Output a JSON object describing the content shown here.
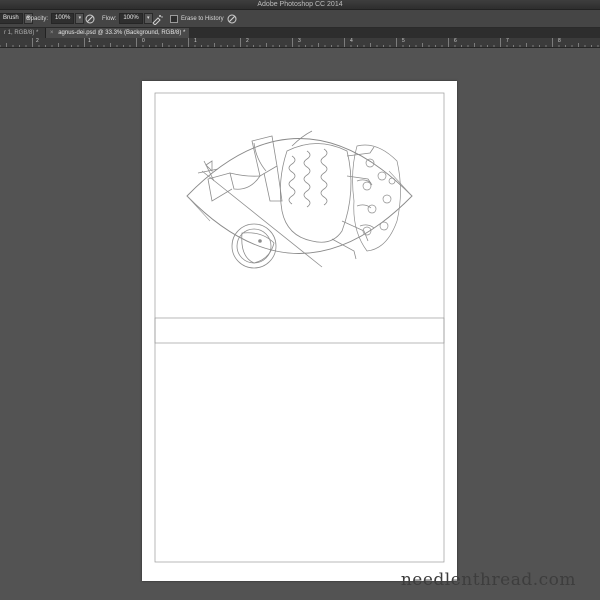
{
  "titlebar": {
    "title": "Adobe Photoshop CC 2014"
  },
  "options_bar": {
    "tool_label": "Brush",
    "opacity_label": "Opacity:",
    "opacity_value": "100%",
    "flow_label": "Flow:",
    "flow_value": "100%",
    "erase_to_history_label": "Erase to History"
  },
  "tabs": [
    {
      "label": "r 1, RGB/8) *",
      "active": false
    },
    {
      "label": "agnus-dei.psd @ 33.3% (Background, RGB/8) *",
      "active": true
    }
  ],
  "ruler": {
    "labels": [
      "2",
      "1",
      "0",
      "1",
      "2",
      "3",
      "4",
      "5",
      "6",
      "7",
      "8"
    ]
  },
  "watermark": {
    "text": "needlenthread.com"
  }
}
